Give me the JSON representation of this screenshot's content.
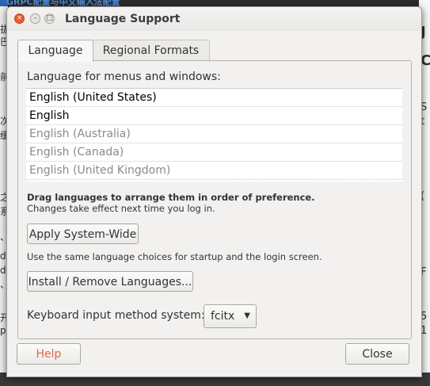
{
  "background": {
    "top_text": "GRPC配置与中文输入法配置",
    "left_glyphs": [
      "拔",
      "巴",
      "前",
      "次",
      "缓",
      "之",
      "系",
      "、",
      "d",
      "d",
      "、",
      "开",
      "p"
    ],
    "right_glyphs": [
      "J",
      "C",
      "S",
      "t",
      "(",
      "",
      "F",
      "5",
      "1"
    ]
  },
  "window": {
    "title": "Language Support",
    "controls": {
      "close": "×",
      "minimize": "–",
      "maximize": "□"
    }
  },
  "tabs": [
    {
      "label": "Language",
      "active": true
    },
    {
      "label": "Regional Formats",
      "active": false
    }
  ],
  "language_tab": {
    "heading": "Language for menus and windows:",
    "languages": [
      {
        "name": "English (United States)",
        "enabled": true
      },
      {
        "name": "English",
        "enabled": true
      },
      {
        "name": "English (Australia)",
        "enabled": false
      },
      {
        "name": "English (Canada)",
        "enabled": false
      },
      {
        "name": "English (United Kingdom)",
        "enabled": false
      }
    ],
    "drag_hint_bold": "Drag languages to arrange them in order of preference.",
    "drag_hint_note": "Changes take effect next time you log in.",
    "apply_button": "Apply System-Wide",
    "apply_note": "Use the same language choices for startup and the login screen.",
    "install_button": "Install / Remove Languages...",
    "keyboard_label": "Keyboard input method system:",
    "keyboard_value": "fcitx",
    "keyboard_arrow": "▼"
  },
  "footer": {
    "help_button": "Help",
    "close_button": "Close"
  },
  "colors": {
    "close_button": "#e9592a",
    "help_text": "#e0684a",
    "disabled_text": "#8a8a8a"
  }
}
